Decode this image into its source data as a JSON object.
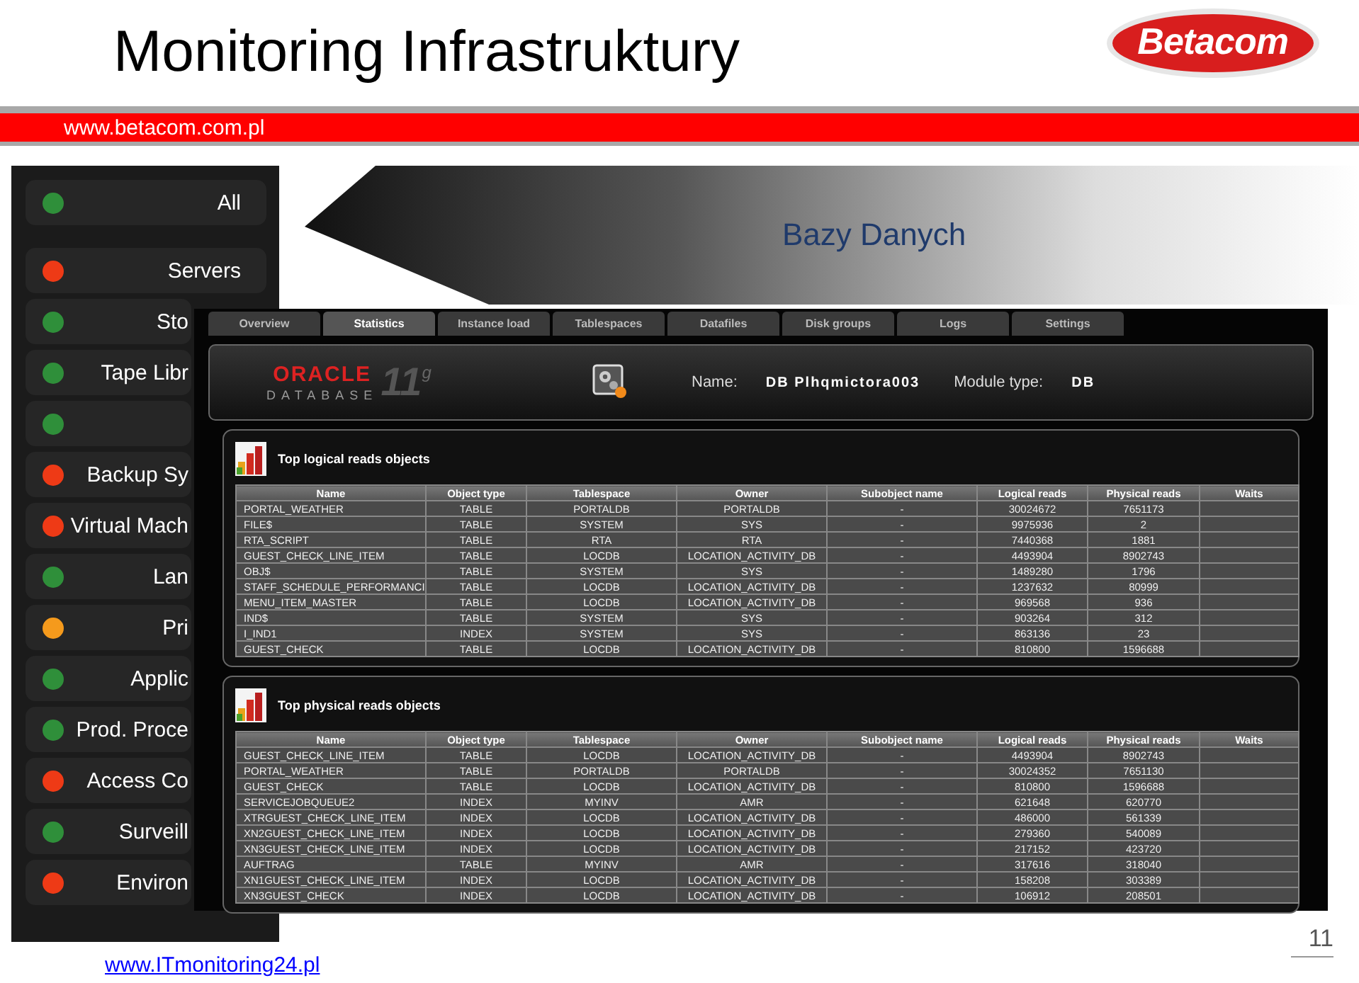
{
  "slide": {
    "title": "Monitoring Infrastruktury",
    "logo": "Betacom",
    "url": "www.betacom.com.pl",
    "footer_link": "www.ITmonitoring24.pl",
    "page_number": "11",
    "banner": "Bazy Danych"
  },
  "sidebar": {
    "items": [
      {
        "label": "All",
        "color": "#2f8f3a"
      },
      {
        "label": "Servers",
        "color": "#ee3a16"
      },
      {
        "label": "Sto",
        "color": "#2f8f3a"
      },
      {
        "label": "Tape Libr",
        "color": "#2f8f3a"
      },
      {
        "color": "#2f8f3a"
      },
      {
        "label": "Backup Sy",
        "color": "#ee3a16"
      },
      {
        "label": "Virtual Mach",
        "color": "#ee3a16"
      },
      {
        "label": "Lan",
        "color": "#2f8f3a"
      },
      {
        "label": "Pri",
        "color": "#f59a1c"
      },
      {
        "label": "Applic",
        "color": "#2f8f3a"
      },
      {
        "label": "Prod. Proce",
        "color": "#2f8f3a"
      },
      {
        "label": "Access Co",
        "color": "#ee3a16"
      },
      {
        "label": "Surveill",
        "color": "#2f8f3a"
      },
      {
        "label": "Environ",
        "color": "#ee3a16"
      }
    ]
  },
  "app": {
    "tabs": [
      {
        "label": "Overview",
        "selected": false
      },
      {
        "label": "Statistics",
        "selected": true
      },
      {
        "label": "Instance load",
        "selected": false
      },
      {
        "label": "Tablespaces",
        "selected": false
      },
      {
        "label": "Datafiles",
        "selected": false
      },
      {
        "label": "Disk groups",
        "selected": false
      },
      {
        "label": "Logs",
        "selected": false
      },
      {
        "label": "Settings",
        "selected": false
      }
    ],
    "oracle_logo": {
      "brand": "ORACLE",
      "product": "DATABASE",
      "version": "11",
      "edition": "g"
    },
    "name_label": "Name:",
    "name_value": "DB Plhqmictora003",
    "module_label": "Module type:",
    "module_value": "DB",
    "tables": [
      {
        "title": "Top logical reads objects",
        "columns": [
          "Name",
          "Object type",
          "Tablespace",
          "Owner",
          "Subobject name",
          "Logical reads",
          "Physical reads",
          "Waits"
        ],
        "rows": [
          [
            "PORTAL_WEATHER",
            "TABLE",
            "PORTALDB",
            "PORTALDB",
            "-",
            "30024672",
            "7651173"
          ],
          [
            "FILE$",
            "TABLE",
            "SYSTEM",
            "SYS",
            "-",
            "9975936",
            "2"
          ],
          [
            "RTA_SCRIPT",
            "TABLE",
            "RTA",
            "RTA",
            "-",
            "7440368",
            "1881"
          ],
          [
            "GUEST_CHECK_LINE_ITEM",
            "TABLE",
            "LOCDB",
            "LOCATION_ACTIVITY_DB",
            "-",
            "4493904",
            "8902743"
          ],
          [
            "OBJ$",
            "TABLE",
            "SYSTEM",
            "SYS",
            "-",
            "1489280",
            "1796"
          ],
          [
            "STAFF_SCHEDULE_PERFORMANCI",
            "TABLE",
            "LOCDB",
            "LOCATION_ACTIVITY_DB",
            "-",
            "1237632",
            "80999"
          ],
          [
            "MENU_ITEM_MASTER",
            "TABLE",
            "LOCDB",
            "LOCATION_ACTIVITY_DB",
            "-",
            "969568",
            "936"
          ],
          [
            "IND$",
            "TABLE",
            "SYSTEM",
            "SYS",
            "-",
            "903264",
            "312"
          ],
          [
            "I_IND1",
            "INDEX",
            "SYSTEM",
            "SYS",
            "-",
            "863136",
            "23"
          ],
          [
            "GUEST_CHECK",
            "TABLE",
            "LOCDB",
            "LOCATION_ACTIVITY_DB",
            "-",
            "810800",
            "1596688"
          ]
        ]
      },
      {
        "title": "Top physical reads objects",
        "columns": [
          "Name",
          "Object type",
          "Tablespace",
          "Owner",
          "Subobject name",
          "Logical reads",
          "Physical reads",
          "Waits"
        ],
        "rows": [
          [
            "GUEST_CHECK_LINE_ITEM",
            "TABLE",
            "LOCDB",
            "LOCATION_ACTIVITY_DB",
            "-",
            "4493904",
            "8902743"
          ],
          [
            "PORTAL_WEATHER",
            "TABLE",
            "PORTALDB",
            "PORTALDB",
            "-",
            "30024352",
            "7651130"
          ],
          [
            "GUEST_CHECK",
            "TABLE",
            "LOCDB",
            "LOCATION_ACTIVITY_DB",
            "-",
            "810800",
            "1596688"
          ],
          [
            "SERVICEJOBQUEUE2",
            "INDEX",
            "MYINV",
            "AMR",
            "-",
            "621648",
            "620770"
          ],
          [
            "XTRGUEST_CHECK_LINE_ITEM",
            "INDEX",
            "LOCDB",
            "LOCATION_ACTIVITY_DB",
            "-",
            "486000",
            "561339"
          ],
          [
            "XN2GUEST_CHECK_LINE_ITEM",
            "INDEX",
            "LOCDB",
            "LOCATION_ACTIVITY_DB",
            "-",
            "279360",
            "540089"
          ],
          [
            "XN3GUEST_CHECK_LINE_ITEM",
            "INDEX",
            "LOCDB",
            "LOCATION_ACTIVITY_DB",
            "-",
            "217152",
            "423720"
          ],
          [
            "AUFTRAG",
            "TABLE",
            "MYINV",
            "AMR",
            "-",
            "317616",
            "318040"
          ],
          [
            "XN1GUEST_CHECK_LINE_ITEM",
            "INDEX",
            "LOCDB",
            "LOCATION_ACTIVITY_DB",
            "-",
            "158208",
            "303389"
          ],
          [
            "XN3GUEST_CHECK",
            "INDEX",
            "LOCDB",
            "LOCATION_ACTIVITY_DB",
            "-",
            "106912",
            "208501"
          ]
        ]
      }
    ]
  }
}
